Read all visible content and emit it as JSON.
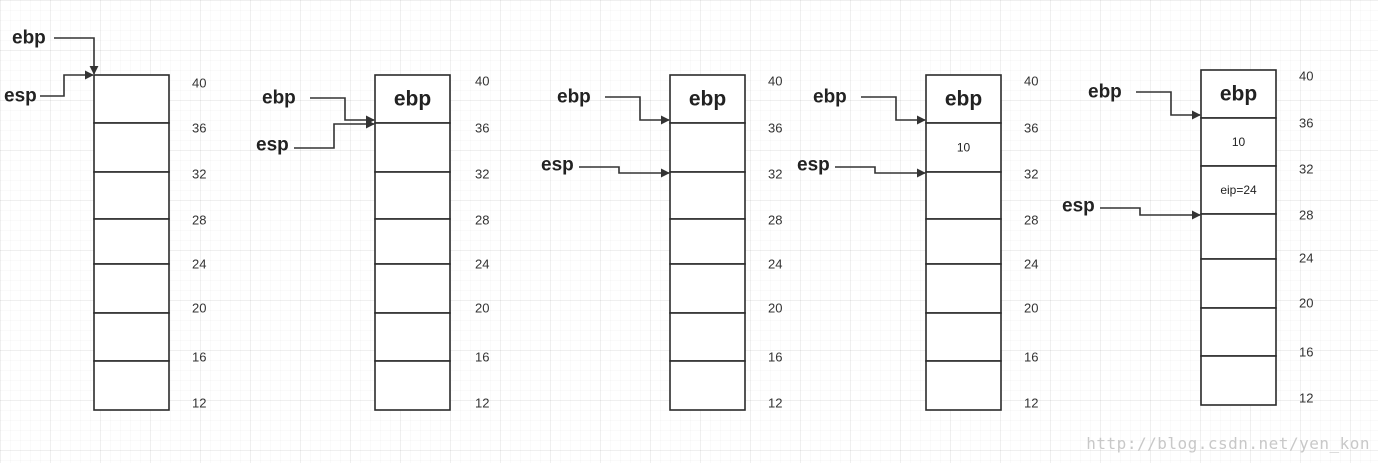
{
  "labels": {
    "ebp": "ebp",
    "esp": "esp"
  },
  "addresses": [
    "40",
    "36",
    "32",
    "28",
    "24",
    "20",
    "16",
    "12"
  ],
  "watermark": "http://blog.csdn.net/yen_kon",
  "snapshots": [
    {
      "cells": [
        "",
        "",
        "",
        "",
        "",
        "",
        ""
      ],
      "ebp_points_to": "40",
      "esp_points_to": "40"
    },
    {
      "cells": [
        "ebp",
        "",
        "",
        "",
        "",
        "",
        ""
      ],
      "ebp_points_to": "36",
      "esp_points_to": "36"
    },
    {
      "cells": [
        "ebp",
        "",
        "",
        "",
        "",
        "",
        ""
      ],
      "ebp_points_to": "36",
      "esp_points_to": "32"
    },
    {
      "cells": [
        "ebp",
        "10",
        "",
        "",
        "",
        "",
        ""
      ],
      "ebp_points_to": "36",
      "esp_points_to": "32"
    },
    {
      "cells": [
        "ebp",
        "10",
        "eip=24",
        "",
        "",
        "",
        ""
      ],
      "ebp_points_to": "36",
      "esp_points_to": "28"
    }
  ]
}
